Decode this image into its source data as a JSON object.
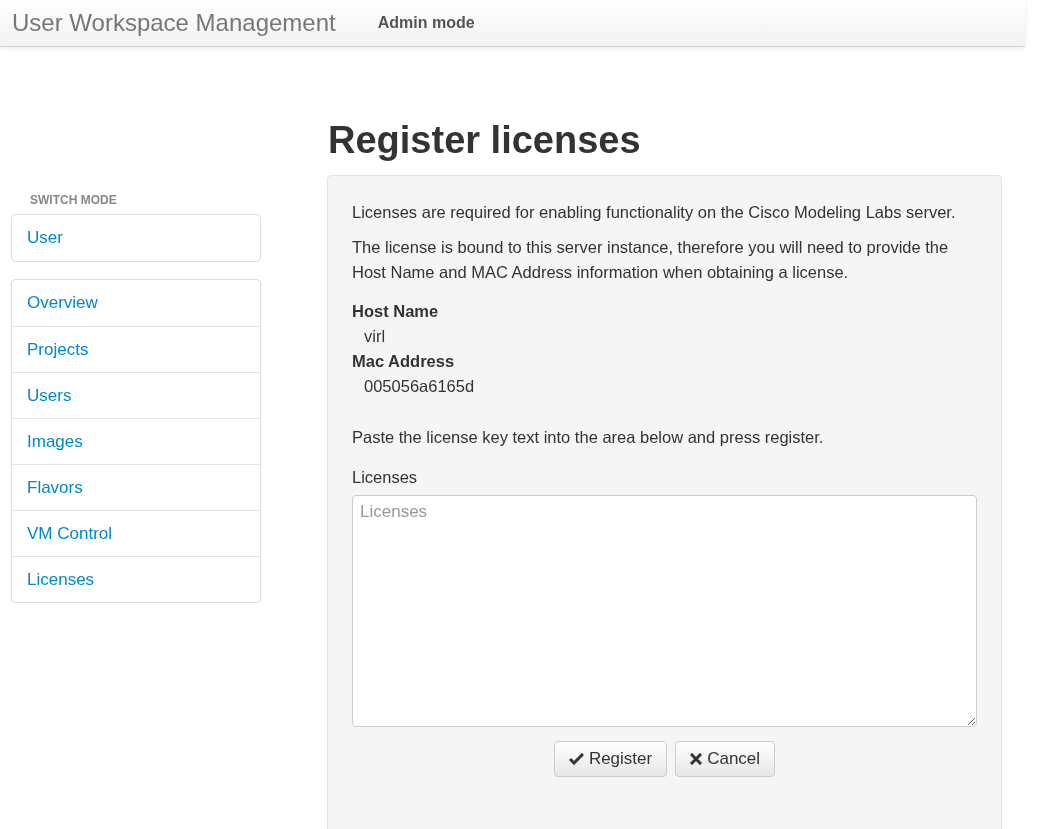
{
  "navbar": {
    "brand": "User Workspace Management",
    "mode": "Admin mode"
  },
  "sidebar": {
    "heading": "SWITCH MODE",
    "switch_items": [
      {
        "label": "User"
      }
    ],
    "items": [
      {
        "label": "Overview"
      },
      {
        "label": "Projects"
      },
      {
        "label": "Users"
      },
      {
        "label": "Images"
      },
      {
        "label": "Flavors"
      },
      {
        "label": "VM Control"
      },
      {
        "label": "Licenses"
      }
    ]
  },
  "page_title": "Register licenses",
  "panel": {
    "paragraphs": [
      "Licenses are required for enabling functionality on the Cisco Modeling Labs server.",
      "The license is bound to this server instance, therefore you will need to provide the Host Name and MAC Address information when obtaining a license."
    ],
    "details": [
      {
        "term": "Host Name",
        "value": "virl"
      },
      {
        "term": "Mac Address",
        "value": "005056a6165d"
      }
    ],
    "instruction": "Paste the license key text into the area below and press register.",
    "field_label": "Licenses",
    "field_placeholder": "Licenses",
    "buttons": [
      {
        "kind": "register",
        "label": "Register"
      },
      {
        "kind": "cancel",
        "label": "Cancel"
      }
    ]
  }
}
